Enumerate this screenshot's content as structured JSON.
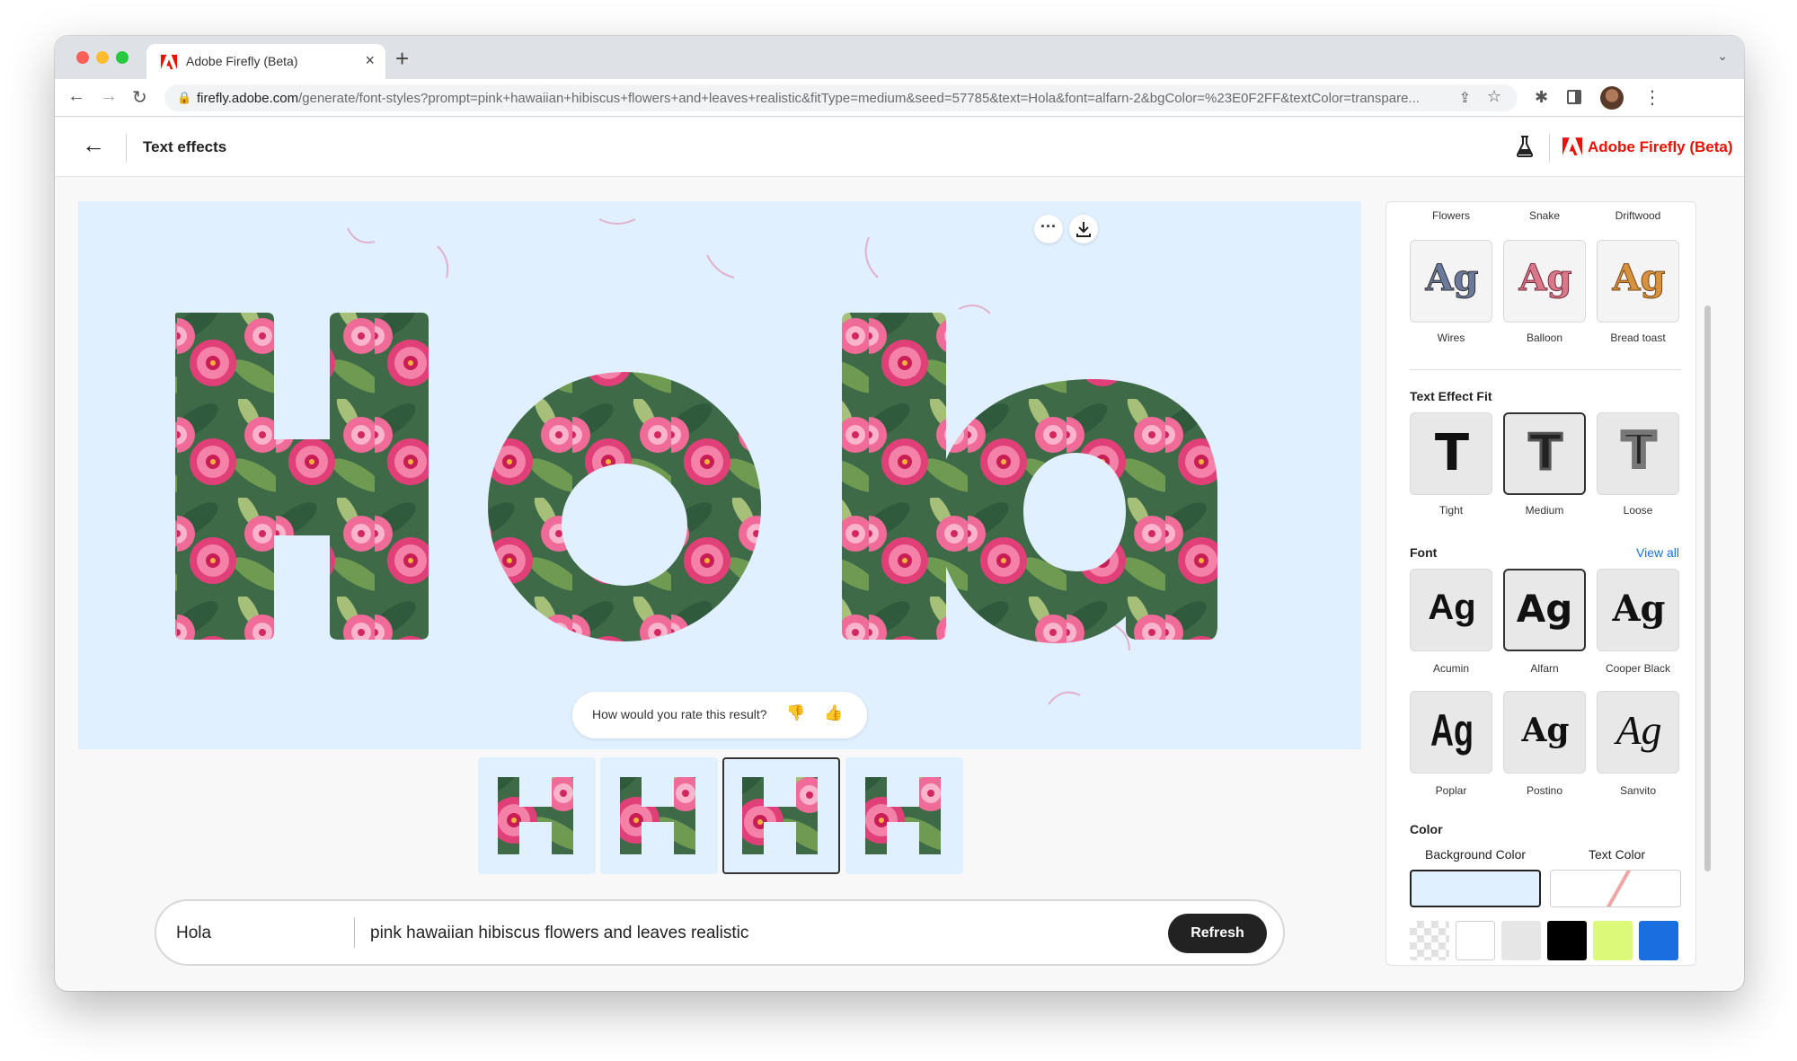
{
  "browser": {
    "tab_title": "Adobe Firefly (Beta)",
    "url_host": "firefly.adobe.com",
    "url_path": "/generate/font-styles?prompt=pink+hawaiian+hibiscus+flowers+and+leaves+realistic&fitType=medium&seed=57785&text=Hola&font=alfarn-2&bgColor=%23E0F2FF&textColor=transpare..."
  },
  "app": {
    "page_title": "Text effects",
    "brand_name": "Adobe Firefly (Beta)"
  },
  "canvas": {
    "display_text": "Hola",
    "background_color": "#E0F0FF",
    "rate_prompt": "How would you rate this result?",
    "rate_down_icon": "thumbs-down-icon",
    "rate_up_icon": "thumbs-up-icon",
    "variations": [
      {
        "letter": "H",
        "selected": false
      },
      {
        "letter": "H",
        "selected": false
      },
      {
        "letter": "H",
        "selected": true
      },
      {
        "letter": "H",
        "selected": false
      }
    ]
  },
  "prompt": {
    "text": "Hola",
    "description": "pink hawaiian hibiscus flowers and leaves realistic",
    "refresh_label": "Refresh"
  },
  "panel": {
    "style_row_top": [
      "Flowers",
      "Snake",
      "Driftwood"
    ],
    "style_tiles": [
      {
        "label": "Wires",
        "sample": "Ag"
      },
      {
        "label": "Balloon",
        "sample": "Ag"
      },
      {
        "label": "Bread toast",
        "sample": "Ag"
      }
    ],
    "fit": {
      "title": "Text Effect Fit",
      "options": [
        {
          "label": "Tight",
          "sample": "T",
          "selected": false
        },
        {
          "label": "Medium",
          "sample": "T",
          "selected": true
        },
        {
          "label": "Loose",
          "sample": "T",
          "selected": false
        }
      ]
    },
    "font": {
      "title": "Font",
      "view_all": "View all",
      "options": [
        {
          "label": "Acumin",
          "sample": "Ag",
          "selected": false
        },
        {
          "label": "Alfarn",
          "sample": "Ag",
          "selected": true
        },
        {
          "label": "Cooper Black",
          "sample": "Ag",
          "selected": false
        },
        {
          "label": "Poplar",
          "sample": "Ag",
          "selected": false
        },
        {
          "label": "Postino",
          "sample": "Ag",
          "selected": false
        },
        {
          "label": "Sanvito",
          "sample": "Ag",
          "selected": false
        }
      ]
    },
    "color": {
      "title": "Color",
      "background_label": "Background Color",
      "text_label": "Text Color",
      "background_value": "#E0F0FF",
      "text_value": "transparent",
      "swatches": [
        "transparent",
        "#FFFFFF",
        "#E6E6E6",
        "#000000",
        "#DDF97A",
        "#1A6EE0"
      ]
    }
  }
}
